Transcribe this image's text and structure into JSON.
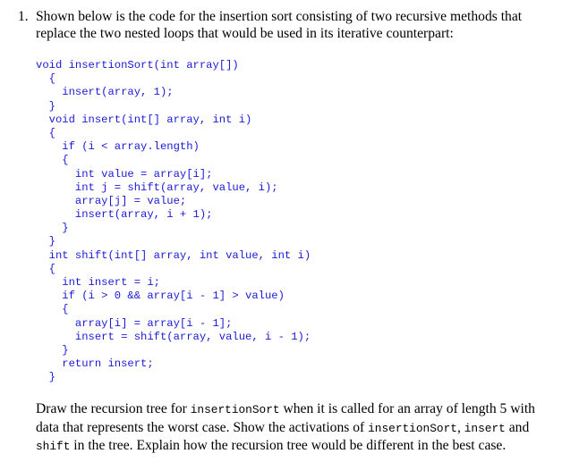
{
  "question": {
    "number": "1.",
    "intro": "Shown below is the code for the insertion sort consisting of two recursive methods that replace the two nested loops that would be used in its iterative counterpart:"
  },
  "code": {
    "lines": [
      "void insertionSort(int array[])",
      "  {",
      "    insert(array, 1);",
      "  }",
      "  void insert(int[] array, int i)",
      "  {",
      "    if (i < array.length)",
      "    {",
      "      int value = array[i];",
      "      int j = shift(array, value, i);",
      "      array[j] = value;",
      "      insert(array, i + 1);",
      "    }",
      "  }",
      "  int shift(int[] array, int value, int i)",
      "  {",
      "    int insert = i;",
      "    if (i > 0 && array[i - 1] > value)",
      "    {",
      "      array[i] = array[i - 1];",
      "      insert = shift(array, value, i - 1);",
      "    }",
      "    return insert;",
      "  }"
    ],
    "text_color": "#1a1ad6"
  },
  "prompt": {
    "seg1": "Draw the recursion tree for ",
    "code1": "insertionSort",
    "seg2": " when it is called for an array of length 5 with data that represents the worst case. Show the activations of ",
    "code2": "insertionSort",
    "seg3": ", ",
    "code3": "insert",
    "seg4": " and ",
    "code4": "shift",
    "seg5": " in the tree. Explain how the recursion tree would be different in the best case."
  }
}
